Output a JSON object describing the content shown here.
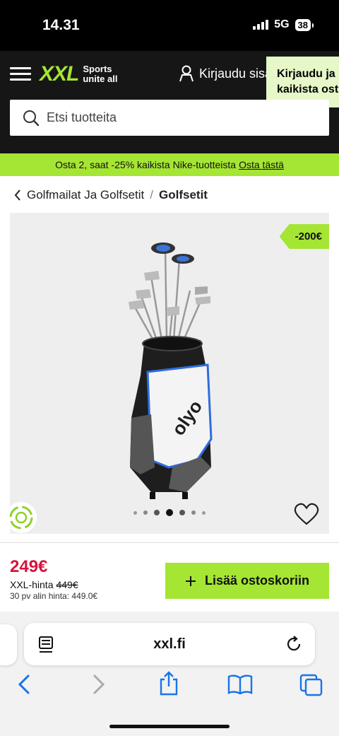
{
  "status_bar": {
    "time": "14.31",
    "network": "5G",
    "battery": "38"
  },
  "header": {
    "logo_text": "XXL",
    "logo_tagline_1": "Sports",
    "logo_tagline_2": "unite all",
    "login_label": "Kirjaudu sisään",
    "popup_line_1": "Kirjaudu ja",
    "popup_line_2": "kaikista ost"
  },
  "search": {
    "placeholder": "Etsi tuotteita"
  },
  "promo": {
    "text": "Osta 2, saat -25% kaikista Nike-tuotteista",
    "link": "Osta tästä"
  },
  "breadcrumb": {
    "parent": "Golfmailat Ja Golfsetit",
    "separator": "/",
    "current": "Golfsetit"
  },
  "gallery": {
    "badge": "-200€",
    "dot_count": 7,
    "active_dot": 3,
    "bag_brand": "olyo"
  },
  "purchase": {
    "price": "249€",
    "ref_label": "XXL-hinta",
    "ref_price": "449€",
    "lowest_30d": "30 pv alin hinta: 449.0€",
    "add_to_cart": "Lisää ostoskoriin"
  },
  "browser": {
    "url": "xxl.fi"
  },
  "colors": {
    "brand_lime": "#a5e533",
    "sale_red": "#d7143c",
    "header_dark": "#161616"
  },
  "icons": [
    "menu-icon",
    "user-icon",
    "search-icon",
    "chevron-left-icon",
    "heart-icon",
    "eco-icon",
    "plus-icon",
    "reader-icon",
    "reload-icon",
    "back-icon",
    "forward-icon",
    "share-icon",
    "bookmarks-icon",
    "tabs-icon"
  ]
}
